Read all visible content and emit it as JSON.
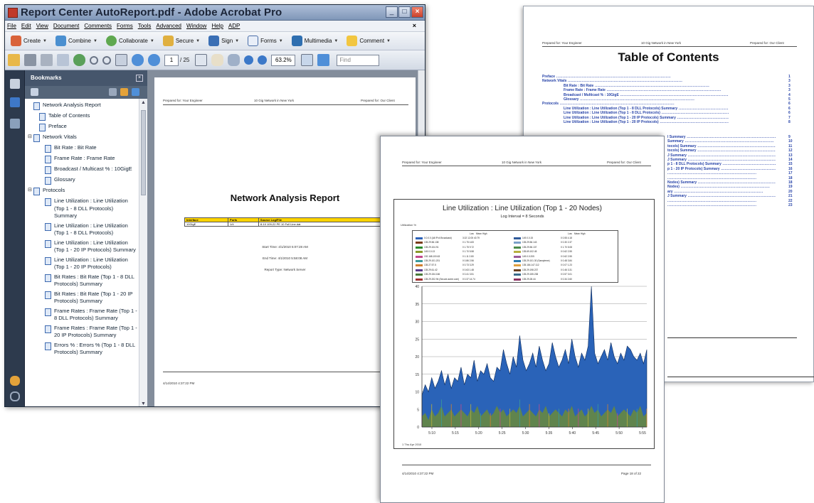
{
  "acrobat": {
    "title": "Report Center AutoReport.pdf - Adobe Acrobat Pro",
    "menu": [
      "File",
      "Edit",
      "View",
      "Document",
      "Comments",
      "Forms",
      "Tools",
      "Advanced",
      "Window",
      "Help",
      "ADP"
    ],
    "tasks": [
      "Create",
      "Combine",
      "Collaborate",
      "Secure",
      "Sign",
      "Forms",
      "Multimedia",
      "Comment"
    ],
    "page_current": "1",
    "page_total": "/ 25",
    "zoom": "63.2%",
    "find_placeholder": "Find",
    "bookmarks_label": "Bookmarks",
    "bookmarks": [
      {
        "label": "Network Analysis Report",
        "indent": 0,
        "exp": ""
      },
      {
        "label": "Table of Contents",
        "indent": 1,
        "exp": ""
      },
      {
        "label": "Preface",
        "indent": 1,
        "exp": ""
      },
      {
        "label": "Network Vitals",
        "indent": 0,
        "exp": "⊟"
      },
      {
        "label": "Bit Rate : Bit Rate",
        "indent": 2,
        "exp": ""
      },
      {
        "label": "Frame Rate : Frame Rate",
        "indent": 2,
        "exp": ""
      },
      {
        "label": "Broadcast / Multicast % : 10GigE",
        "indent": 2,
        "exp": ""
      },
      {
        "label": "Glossary",
        "indent": 2,
        "exp": ""
      },
      {
        "label": "Protocols",
        "indent": 0,
        "exp": "⊟"
      },
      {
        "label": "Line Utilization : Line Utilization (Top 1 - 8 DLL Protocols) Summary",
        "indent": 2,
        "exp": ""
      },
      {
        "label": "Line Utilization : Line Utilization (Top 1 - 8 DLL Protocols)",
        "indent": 2,
        "exp": ""
      },
      {
        "label": "Line Utilization : Line Utilization (Top 1 - 20 IP Protocols) Summary",
        "indent": 2,
        "exp": ""
      },
      {
        "label": "Line Utilization : Line Utilization (Top 1 - 20 IP Protocols)",
        "indent": 2,
        "exp": ""
      },
      {
        "label": "Bit Rates : Bit Rate (Top 1 - 8 DLL Protocols) Summary",
        "indent": 2,
        "exp": ""
      },
      {
        "label": "Bit Rates : Bit Rate (Top 1 - 20 IP Protocols) Summary",
        "indent": 2,
        "exp": ""
      },
      {
        "label": "Frame Rates : Frame Rate (Top 1 - 8 DLL Protocols) Summary",
        "indent": 2,
        "exp": ""
      },
      {
        "label": "Frame Rates : Frame Rate (Top 1 - 20 IP Protocols) Summary",
        "indent": 2,
        "exp": ""
      },
      {
        "label": "Errors % : Errors % (Top 1 - 8 DLL Protocols) Summary",
        "indent": 2,
        "exp": ""
      }
    ]
  },
  "page1": {
    "header_left": "Prepared for: Your Engineer",
    "header_mid": "10 Gig Network in New York",
    "header_right": "Prepared for: Our Client",
    "title": "Network Analysis Report",
    "table_headers": [
      "Interface",
      "Ports",
      "Source Log/File"
    ],
    "table_row": [
      "10GigE",
      "1/4",
      "8-10 109-22 PE 10 Full Line.dat"
    ],
    "start_time": "Start Time: 4/1/2010 5:07:28 AM",
    "end_time": "End Time: 4/1/2010 5:58:08 AM",
    "report_type": "Report Type: Network Server",
    "footer": "4/14/2010 4:37:22 PM"
  },
  "toc": {
    "header_left": "Prepared for: Your Engineer",
    "header_mid": "10 Gig Network in New York",
    "header_right": "Prepared for: Our Client",
    "title": "Table of Contents",
    "entries": [
      {
        "text": "Preface",
        "page": "1",
        "indent": 0
      },
      {
        "text": "Network Vitals",
        "page": "3",
        "indent": 0
      },
      {
        "text": "Bit Rate : Bit Rate",
        "page": "3",
        "indent": 1
      },
      {
        "text": "Frame Rate : Frame Rate",
        "page": "3",
        "indent": 1
      },
      {
        "text": "Broadcast / Multicast % : 10GigE",
        "page": "4",
        "indent": 1
      },
      {
        "text": "Glossary",
        "page": "5",
        "indent": 1
      },
      {
        "text": "Protocols",
        "page": "6",
        "indent": 0
      },
      {
        "text": "Line Utilization : Line Utilization (Top 1 - 8 DLL Protocols) Summary",
        "page": "6",
        "indent": 1
      },
      {
        "text": "Line Utilization : Line Utilization (Top 1 - 8 DLL Protocols)",
        "page": "6",
        "indent": 1
      },
      {
        "text": "Line Utilization : Line Utilization (Top 1 - 20 IP Protocols) Summary",
        "page": "7",
        "indent": 1
      },
      {
        "text": "Line Utilization : Line Utilization (Top 1 - 20 IP Protocols)",
        "page": "8",
        "indent": 1
      }
    ],
    "partial_entries": [
      {
        "text": "l Summary",
        "page": "9"
      },
      {
        "text": "Summary",
        "page": "10"
      },
      {
        "text": "tocols) Summary",
        "page": "11"
      },
      {
        "text": "tocols) Summary",
        "page": "12"
      },
      {
        "text": "J Summary",
        "page": "13"
      },
      {
        "text": "J Summary",
        "page": "14"
      },
      {
        "text": "p 1 - 8 DLL Protocols) Summary",
        "page": "15"
      },
      {
        "text": "p 1 - 20 IP Protocols) Summary",
        "page": "16"
      },
      {
        "text": "",
        "page": "17"
      },
      {
        "text": "",
        "page": "18"
      },
      {
        "text": "Nodes) Summary",
        "page": "18"
      },
      {
        "text": "Nodes)",
        "page": "19"
      },
      {
        "text": "ary",
        "page": "20"
      },
      {
        "text": "J Summary",
        "page": "21"
      },
      {
        "text": "",
        "page": "22"
      },
      {
        "text": "",
        "page": "23"
      }
    ]
  },
  "chartpage": {
    "header_left": "Prepared for: Your Engineer",
    "header_mid": "10 Gig Network in New York",
    "header_right": "Prepared for: Our Client",
    "chart_title": "Line Utilization : Line Utilization (Top 1 - 20 Nodes)",
    "chart_subtitle": "Log Interval = 8 Seconds",
    "ylabel": "Utilization %",
    "date_label": "1 Thu Apr 2010",
    "footer_left": "4/14/2010 4:37:22 PM",
    "footer_right": "Page 18 of 22",
    "legend_cols": [
      "Low",
      "Mean",
      "High"
    ],
    "legend_left": [
      {
        "name": "0.0.0.0 (All IPv4 Broadcast)",
        "vals": "3.02 12.05 40.79",
        "color": "#2d62b8"
      },
      {
        "name": "135.29.56.138",
        "vals": "0 1.75 4.83",
        "color": "#7a3b18"
      },
      {
        "name": "135.29.104.91",
        "vals": "0 1.75 9.72",
        "color": "#2a8a2a"
      },
      {
        "name": "149.0.0.13",
        "vals": "0 1.70 5.58",
        "color": "#8a9a2a"
      },
      {
        "name": "192.168.100.63",
        "vals": "0 1.11 2.80",
        "color": "#c24a8c"
      },
      {
        "name": "135.29.101.201",
        "vals": "0 0.86 2.56",
        "color": "#3a9a9a"
      },
      {
        "name": "135.27.57.5",
        "vals": "0 0.73 3.29",
        "color": "#d08030"
      },
      {
        "name": "135.29.61.42",
        "vals": "0 0.63 1.48",
        "color": "#5a3a8a"
      },
      {
        "name": "135.29.154.166",
        "vals": "0 0.41 3.51",
        "color": "#4a7a3a"
      },
      {
        "name": "135.29.202.94 (Secure.acme.com)",
        "vals": "0 0.37 14.74",
        "color": "#a03030"
      }
    ],
    "legend_right": [
      {
        "name": "149.0.0.15",
        "vals": "0 0.55 4.18",
        "color": "#305a9a"
      },
      {
        "name": "135.29.56.143",
        "vals": "0 0.30 2.37",
        "color": "#7aa0c8"
      },
      {
        "name": "135.29.56.137",
        "vals": "0 1.70 5.08",
        "color": "#4a8a4a"
      },
      {
        "name": "135.69.102.45",
        "vals": "0 0.62 2.55",
        "color": "#b8b040"
      },
      {
        "name": "149.0.0.205",
        "vals": "0 0.62 2.55",
        "color": "#9a5a9a"
      },
      {
        "name": "135.29.101.30 (Sampleme)",
        "vals": "0 0.48 3.84",
        "color": "#2a7ab0"
      },
      {
        "name": "135.184.147.112",
        "vals": "0 0.07 1.23",
        "color": "#e0a040"
      },
      {
        "name": "135.29.198.237",
        "vals": "0 0.46 3.31",
        "color": "#6a4020"
      },
      {
        "name": "135.29.155.238",
        "vals": "0 0.57 3.01",
        "color": "#3a6a8a"
      },
      {
        "name": "135.29.28.44",
        "vals": "0 0.34 2.60",
        "color": "#8a3060"
      }
    ]
  },
  "chart_data": {
    "type": "area",
    "title": "Line Utilization : Line Utilization (Top 1 - 20 Nodes)",
    "subtitle": "Log Interval = 8 Seconds",
    "ylabel": "Utilization %",
    "xlabel": "",
    "ylim": [
      0,
      40
    ],
    "yticks": [
      0,
      5,
      10,
      15,
      20,
      25,
      30,
      35,
      40
    ],
    "x_ticks": [
      "5:10",
      "5:15",
      "5:20",
      "5:25",
      "5:30",
      "5:35",
      "5:40",
      "5:45",
      "5:50",
      "5:55"
    ],
    "grid": true,
    "series": [
      {
        "name": "0.0.0.0 (All IPv4 Broadcast)",
        "values": [
          9,
          12,
          10,
          14,
          11,
          13,
          16,
          12,
          15,
          11,
          14,
          13,
          17,
          12,
          15,
          14,
          19,
          13,
          16,
          15,
          18,
          14,
          13,
          17,
          16,
          22,
          18,
          15,
          20,
          17,
          26,
          19,
          16,
          18,
          21,
          17,
          23,
          19,
          16,
          18,
          24,
          20,
          17,
          19,
          22,
          18,
          25,
          20,
          17,
          21,
          19,
          23,
          40,
          21,
          18,
          20,
          22,
          19,
          24,
          20,
          18,
          21,
          19,
          23,
          22,
          20,
          19,
          21,
          18,
          22
        ]
      },
      {
        "name": "135.29.56.138",
        "values": [
          3,
          4,
          2,
          5,
          3,
          4,
          6,
          3,
          4,
          5,
          3,
          4,
          5,
          4,
          3,
          5,
          4,
          6,
          3,
          4,
          5,
          3,
          4,
          6,
          4,
          5,
          3,
          4,
          5,
          4,
          6,
          3,
          4,
          5,
          4,
          3,
          5,
          4,
          6,
          3,
          4,
          5,
          4,
          3,
          5,
          4,
          6,
          3,
          4,
          5,
          3,
          4,
          6,
          4,
          5,
          3,
          4,
          5,
          4,
          6,
          3,
          4,
          5,
          4,
          3,
          5,
          4,
          6,
          3,
          4
        ]
      }
    ]
  }
}
